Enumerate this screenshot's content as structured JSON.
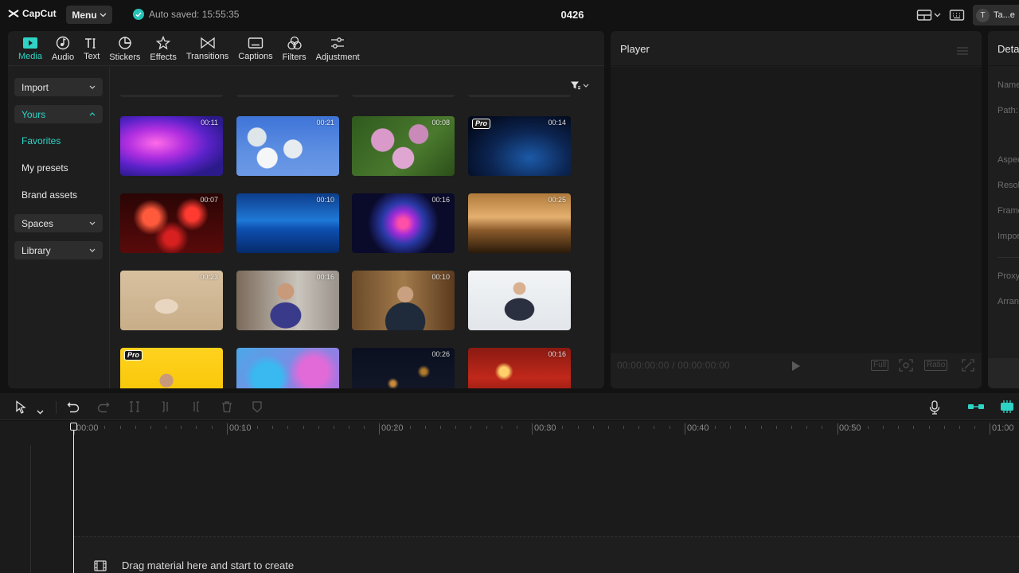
{
  "topbar": {
    "app_name": "CapCut",
    "menu_label": "Menu",
    "autosave_text": "Auto saved: 15:55:35",
    "project_title": "0426",
    "user_initial": "T",
    "user_name": "Ta...e"
  },
  "tool_tabs": [
    {
      "label": "Media",
      "icon": "media-icon",
      "active": true
    },
    {
      "label": "Audio",
      "icon": "audio-icon"
    },
    {
      "label": "Text",
      "icon": "text-icon"
    },
    {
      "label": "Stickers",
      "icon": "stickers-icon"
    },
    {
      "label": "Effects",
      "icon": "effects-icon"
    },
    {
      "label": "Transitions",
      "icon": "transitions-icon"
    },
    {
      "label": "Captions",
      "icon": "captions-icon"
    },
    {
      "label": "Filters",
      "icon": "filters-icon"
    },
    {
      "label": "Adjustment",
      "icon": "adjustment-icon"
    }
  ],
  "side_nav": {
    "import": "Import",
    "yours": "Yours",
    "favorites": "Favorites",
    "my_presets": "My presets",
    "brand_assets": "Brand assets",
    "spaces": "Spaces",
    "library": "Library"
  },
  "media_items": [
    {
      "duration": "00:11",
      "pro": false,
      "scene": "purple-pink abstract"
    },
    {
      "duration": "00:21",
      "pro": false,
      "scene": "white blossoms blue sky"
    },
    {
      "duration": "00:08",
      "pro": false,
      "scene": "pink lilac flowers"
    },
    {
      "duration": "00:14",
      "pro": true,
      "scene": "blue network particles"
    },
    {
      "duration": "00:07",
      "pro": false,
      "scene": "red fireworks"
    },
    {
      "duration": "00:10",
      "pro": false,
      "scene": "blue underwater light"
    },
    {
      "duration": "00:16",
      "pro": false,
      "scene": "colorful nebula"
    },
    {
      "duration": "00:25",
      "pro": false,
      "scene": "silhouettes at sunset"
    },
    {
      "duration": "00:23",
      "pro": false,
      "scene": "man with phone beige"
    },
    {
      "duration": "00:16",
      "pro": false,
      "scene": "man waving"
    },
    {
      "duration": "00:10",
      "pro": false,
      "scene": "man talking at desk"
    },
    {
      "duration": "",
      "pro": false,
      "scene": "businessman on phone"
    },
    {
      "duration": "",
      "pro": true,
      "scene": "man yellow background"
    },
    {
      "duration": "",
      "pro": false,
      "scene": "blue purple ink"
    },
    {
      "duration": "00:26",
      "pro": false,
      "scene": "golden particles"
    },
    {
      "duration": "00:16",
      "pro": false,
      "scene": "red festive room"
    }
  ],
  "pro_badge": "Pro",
  "player": {
    "title": "Player",
    "time_current": "00:00:00:00",
    "time_sep": "/",
    "time_total": "00:00:00:00",
    "full_label": "Full",
    "ratio_label": "Ratio"
  },
  "details": {
    "title": "Details",
    "labels": [
      "Name:",
      "Path:",
      "Aspect ratio:",
      "Resolution:",
      "Frame rate:",
      "Imported:",
      "Proxy:",
      "Arrange layers:"
    ]
  },
  "timeline": {
    "ruler_labels": [
      "00:00",
      "00:10",
      "00:20",
      "00:30",
      "00:40",
      "00:50",
      "01:00"
    ],
    "drop_hint": "Drag material here and start to create"
  },
  "colors": {
    "accent": "#2fd3c5",
    "bg": "#121212",
    "panel": "#1e1e1e"
  }
}
